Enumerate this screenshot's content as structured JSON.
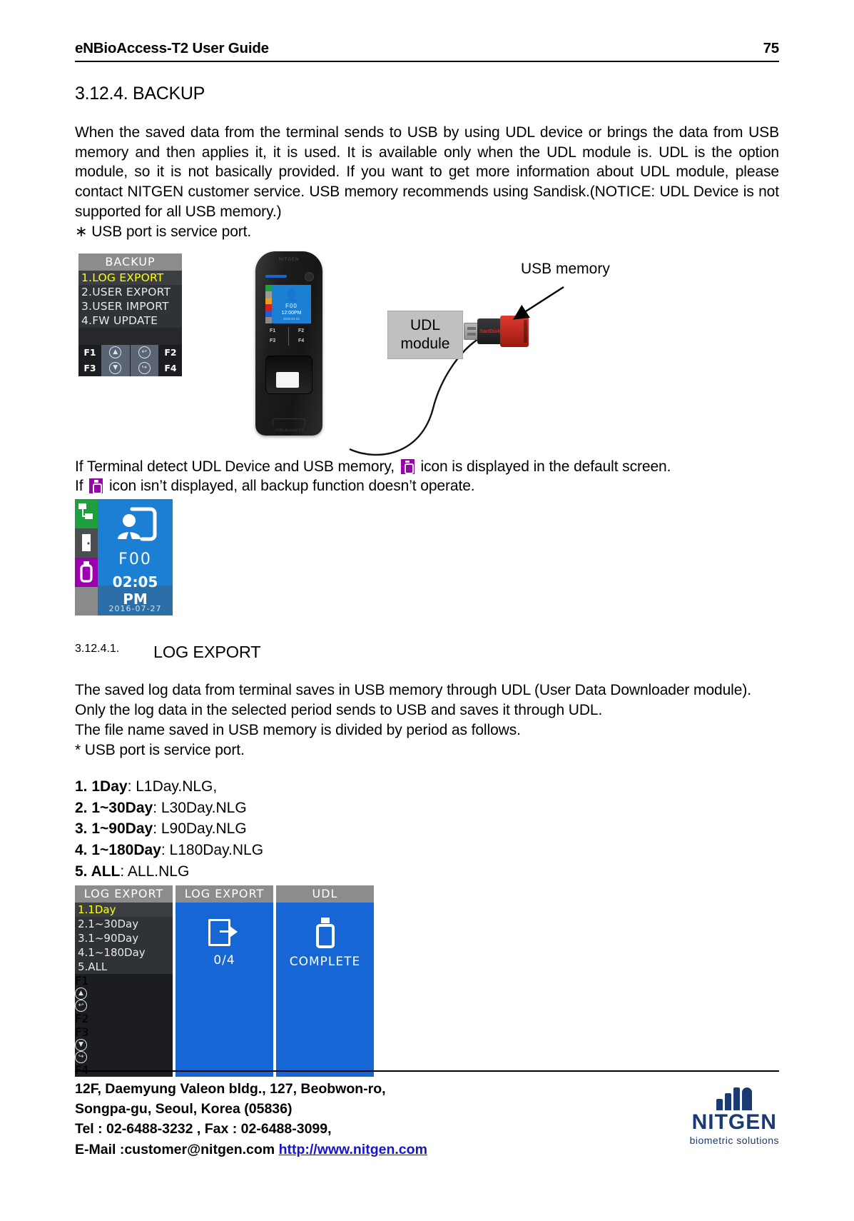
{
  "header": {
    "title": "eNBioAccess-T2 User Guide",
    "page_number": "75"
  },
  "section": {
    "heading": "3.12.4. BACKUP"
  },
  "intro": {
    "paragraph": "When the saved data from the terminal sends to USB by using UDL device or brings the data from USB memory and then applies it, it is used. It is available only when the UDL module is. UDL is the option module, so it is not basically provided. If you want to get more information about UDL module, please contact NITGEN customer service. USB memory recommends using Sandisk.(NOTICE: UDL Device is not supported for all USB memory.)",
    "note": "∗ USB port is service port."
  },
  "figure1": {
    "backup_menu": {
      "title": "BACKUP",
      "items": [
        "1.LOG  EXPORT",
        "2.USER EXPORT",
        "3.USER IMPORT",
        "4.FW UPDATE"
      ],
      "selected_index": 0,
      "fkeys_row1": [
        "F1",
        "up-arrow",
        "back-arrow",
        "F2"
      ],
      "fkeys_row2": [
        "F3",
        "down-arrow",
        "enter-arrow",
        "F4"
      ],
      "fkey_labels": {
        "f1": "F1",
        "f2": "F2",
        "f3": "F3",
        "f4": "F4"
      }
    },
    "terminal": {
      "brand": "NITGEN",
      "screen_user_id": "F00",
      "screen_time": "12:00PM",
      "screen_date": "2016-01-01",
      "fkeys": {
        "f1": "F1",
        "f2": "F2",
        "f3": "F3",
        "f4": "F4"
      },
      "model_label": "eNBioAccess-T2"
    },
    "udl_module_label": "UDL\nmodule",
    "udl_module_line1": "UDL",
    "udl_module_line2": "module",
    "usb_memory_label": "USB memory",
    "usb_brand": "SanDisk"
  },
  "icon_note": {
    "line1_before": "If Terminal detect UDL Device and USB memory,",
    "line1_after": "icon is displayed in the default screen.",
    "line2_before": "If",
    "line2_after": "icon isn’t displayed, all backup function doesn’t operate."
  },
  "default_screen": {
    "user_id": "F00",
    "time": "02:05 PM",
    "date": "2016-07-27",
    "status_icons": [
      "network-icon",
      "door-icon",
      "usb-icon"
    ]
  },
  "subsection": {
    "number": "3.12.4.1.",
    "title": "LOG EXPORT",
    "paragraphs": [
      "The saved log data from terminal saves in USB memory through UDL (User Data Downloader module).",
      "Only the log data in the selected period sends to USB and saves it through UDL.",
      "The file name saved in USB memory is divided by period as follows.",
      "* USB port is service port."
    ]
  },
  "file_list": [
    {
      "label": "1. 1Day",
      "value": ": L1Day.NLG,"
    },
    {
      "label": "2. 1~30Day",
      "value": ": L30Day.NLG"
    },
    {
      "label": "3. 1~90Day",
      "value": ": L90Day.NLG"
    },
    {
      "label": "4. 1~180Day",
      "value": ": L180Day.NLG"
    },
    {
      "label": "5. ALL",
      "value": ": ALL.NLG"
    }
  ],
  "figure2": {
    "menu_screen": {
      "title": "LOG  EXPORT",
      "items": [
        "1.1Day",
        "2.1~30Day",
        "3.1~90Day",
        "4.1~180Day",
        "5.ALL"
      ],
      "selected_index": 0,
      "fkey_labels": {
        "f1": "F1",
        "f2": "F2",
        "f3": "F3",
        "f4": "F4"
      }
    },
    "progress_screen": {
      "title": "LOG  EXPORT",
      "progress": "0/4",
      "icon": "export-icon"
    },
    "complete_screen": {
      "title": "UDL",
      "status": "COMPLETE",
      "icon": "usb-icon"
    }
  },
  "footer": {
    "address_line1": "12F, Daemyung Valeon bldg., 127, Beobwon-ro,",
    "address_line2": "Songpa-gu, Seoul, Korea (05836)",
    "address_line3": "Tel : 02-6488-3232 , Fax : 02-6488-3099,",
    "address_line4_label": "E-Mail :customer@nitgen.com",
    "address_line4_link": "http://www.nitgen.com",
    "logo_name": "NITGEN",
    "logo_tagline": "biometric solutions"
  },
  "colors": {
    "accent_blue": "#1766d6",
    "usb_purple": "#9b00b0",
    "highlight_yellow": "#ffff00",
    "link_blue": "#1414c8",
    "logo_navy": "#1b3a73"
  }
}
